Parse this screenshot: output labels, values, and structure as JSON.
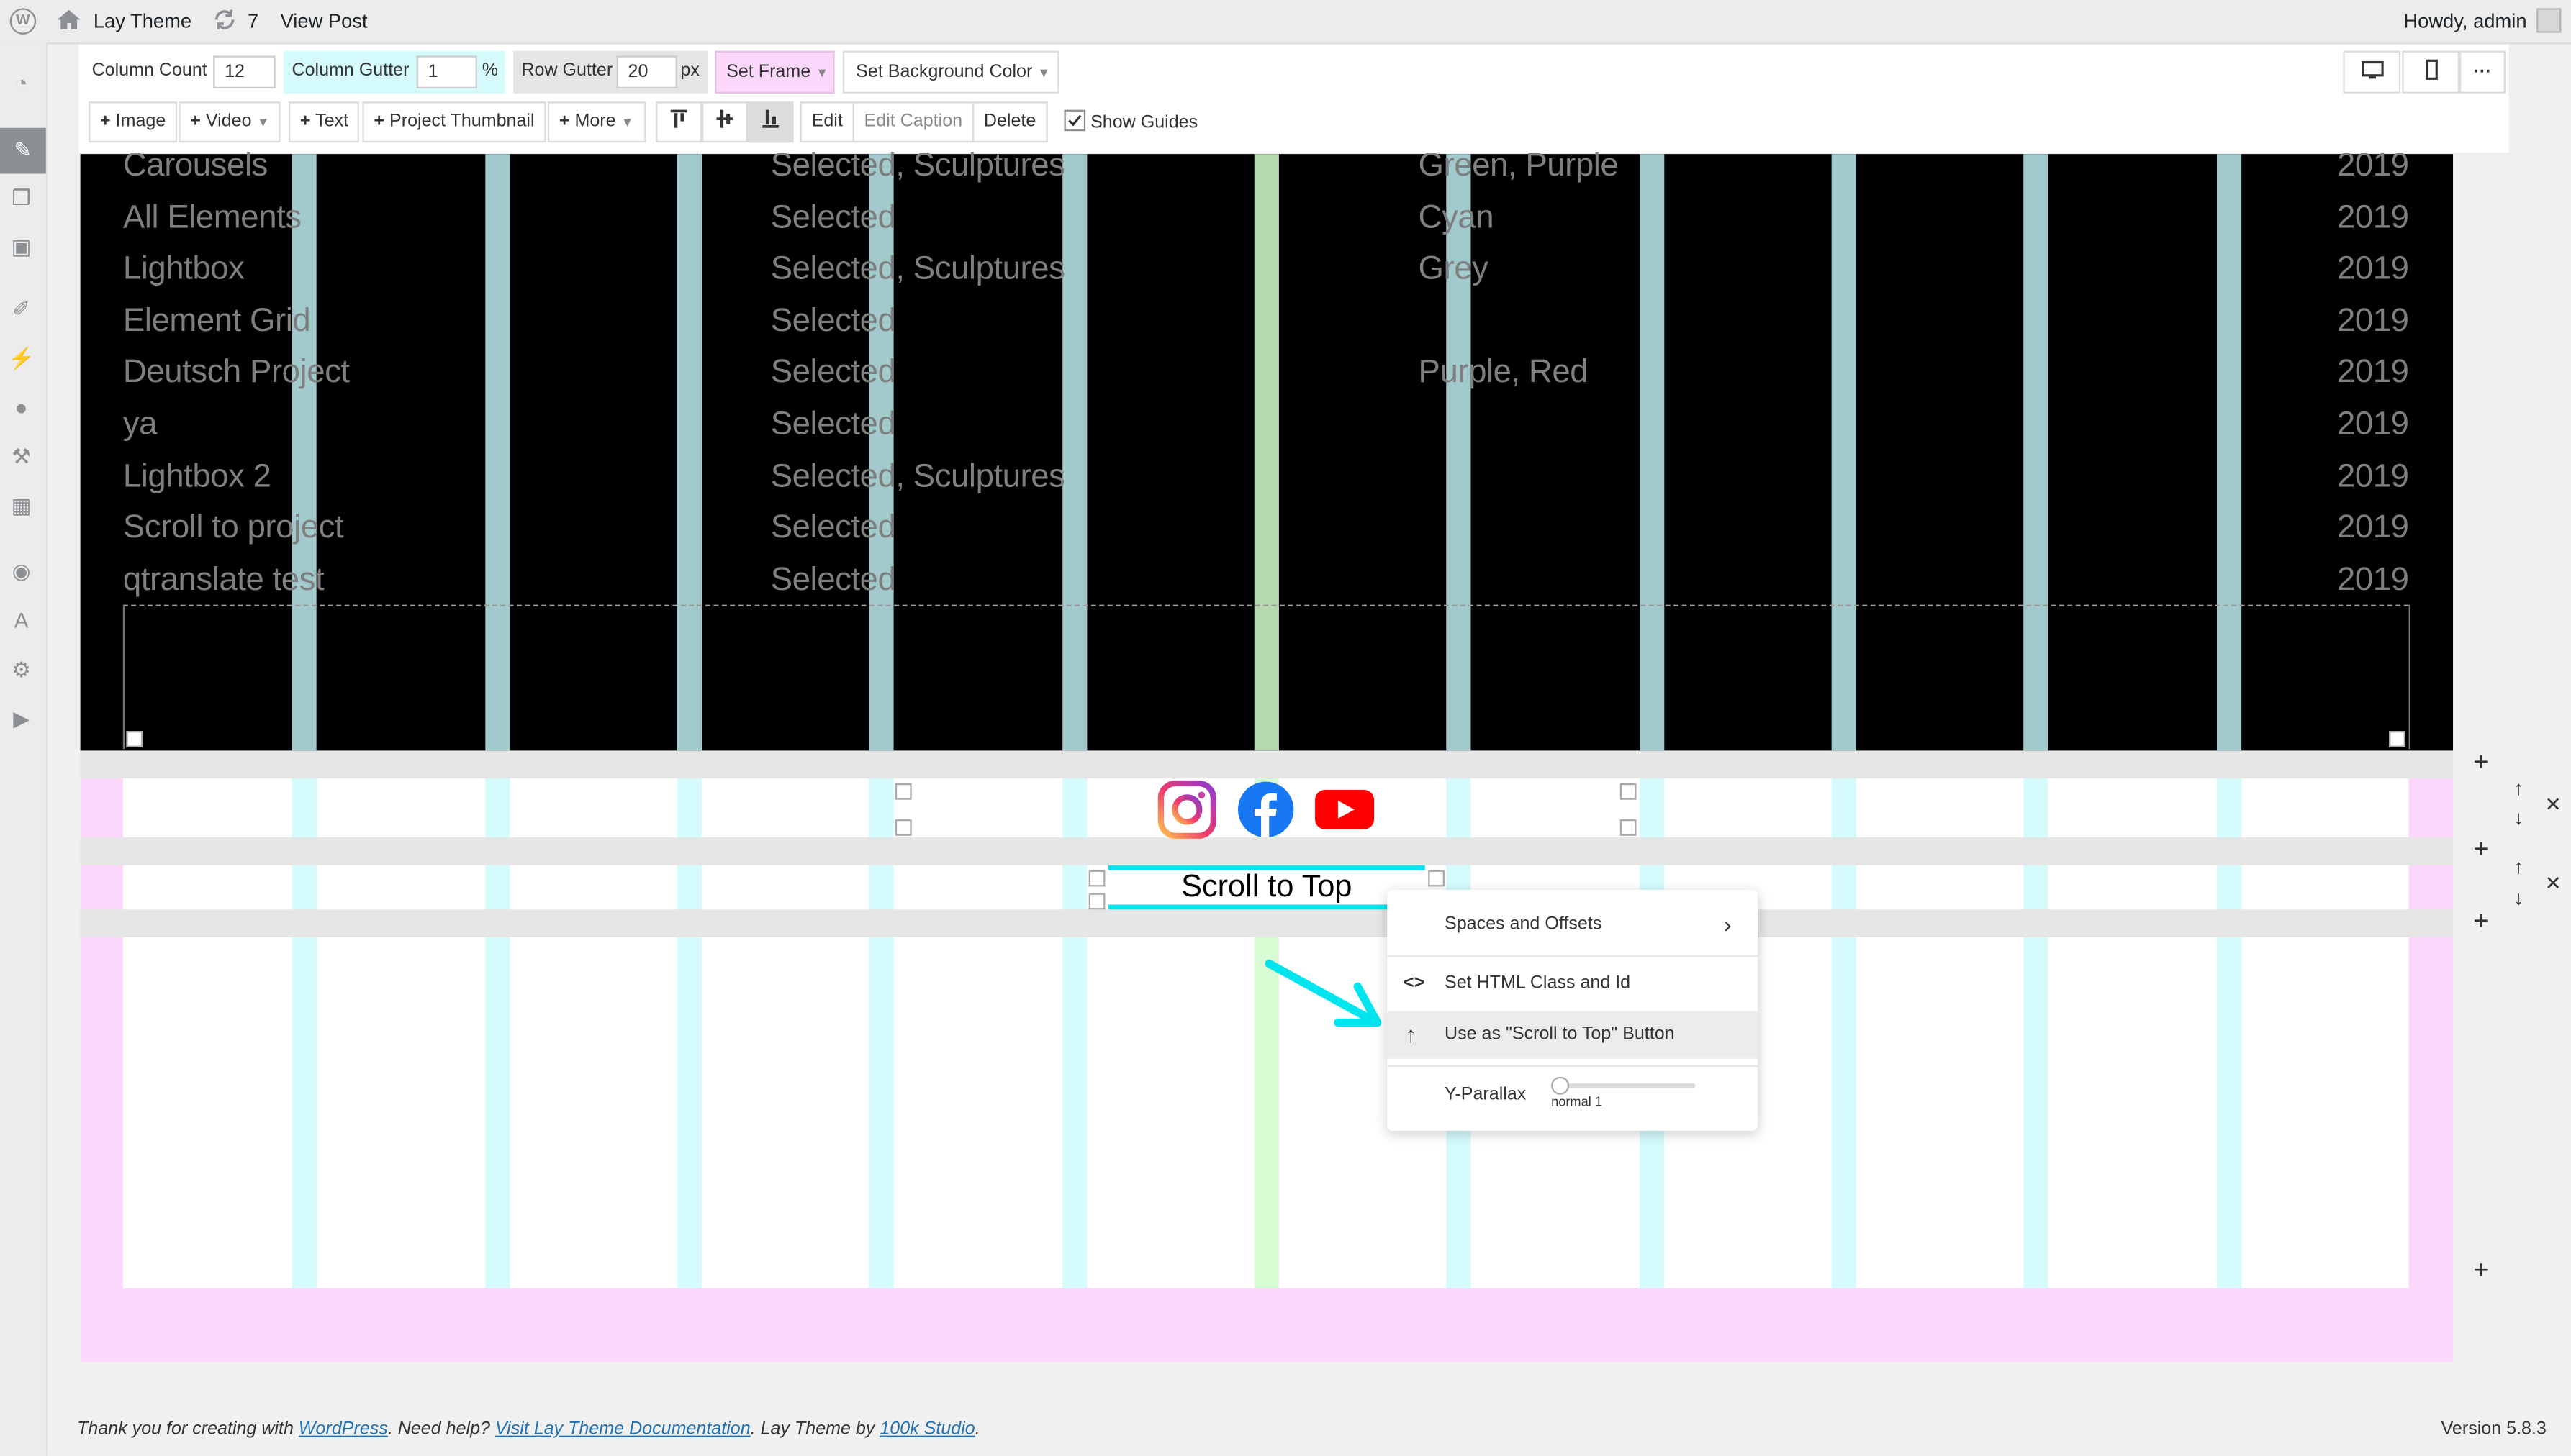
{
  "admin_bar": {
    "site_name": "Lay Theme",
    "updates_count": "7",
    "view_post": "View Post",
    "howdy": "Howdy, admin"
  },
  "toolbar": {
    "column_count_label": "Column Count",
    "column_count_value": "12",
    "column_gutter_label": "Column Gutter",
    "column_gutter_value": "1",
    "column_gutter_unit": "%",
    "row_gutter_label": "Row Gutter",
    "row_gutter_value": "20",
    "row_gutter_unit": "px",
    "set_frame": "Set Frame",
    "set_background_color": "Set Background Color",
    "add_image": "Image",
    "add_video": "Video",
    "add_text": "Text",
    "add_project_thumbnail": "Project Thumbnail",
    "add_more": "More",
    "edit": "Edit",
    "edit_caption": "Edit Caption",
    "delete": "Delete",
    "show_guides": "Show Guides",
    "more_dots": "···"
  },
  "project_list": [
    {
      "title": "Carousels",
      "category": "Selected, Sculptures",
      "tags": "Green, Purple",
      "year": "2019"
    },
    {
      "title": "All Elements",
      "category": "Selected",
      "tags": "Cyan",
      "year": "2019"
    },
    {
      "title": "Lightbox",
      "category": "Selected, Sculptures",
      "tags": "Grey",
      "year": "2019"
    },
    {
      "title": "Element Grid",
      "category": "Selected",
      "tags": "",
      "year": "2019"
    },
    {
      "title": "Deutsch Project",
      "category": "Selected",
      "tags": "Purple, Red",
      "year": "2019"
    },
    {
      "title": "ya",
      "category": "Selected",
      "tags": "",
      "year": "2019"
    },
    {
      "title": "Lightbox 2",
      "category": "Selected, Sculptures",
      "tags": "",
      "year": "2019"
    },
    {
      "title": "Scroll to project",
      "category": "Selected",
      "tags": "",
      "year": "2019"
    },
    {
      "title": "qtranslate test",
      "category": "Selected",
      "tags": "",
      "year": "2019"
    }
  ],
  "scroll_to_top_text": "Scroll to Top",
  "context_menu": {
    "spaces_offsets": "Spaces and Offsets",
    "set_html_class": "Set HTML Class and Id",
    "scroll_to_top_button": "Use as \"Scroll to Top\" Button",
    "y_parallax": "Y-Parallax",
    "parallax_value": "normal 1"
  },
  "footer": {
    "thanks_prefix": "Thank you for creating with ",
    "wordpress_link": "WordPress",
    "need_help": ". Need help? ",
    "docs_link": "Visit Lay Theme Documentation",
    "by_text": ". Lay Theme by ",
    "studio_link": "100k Studio",
    "end": ".",
    "version": "Version 5.8.3"
  },
  "colors": {
    "column_guide": "#a2c9cb",
    "column_guide_light": "#d5fbfd",
    "center_column": "#b6d9b0",
    "frame_pink": "#fbd8fb",
    "gutter_cyan": "#d5fbfd",
    "arrow": "#00e5ee"
  }
}
